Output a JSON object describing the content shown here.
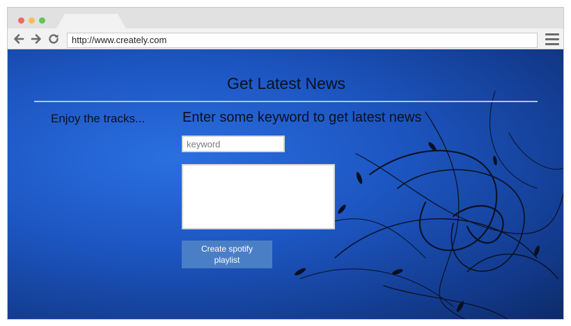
{
  "browser": {
    "url": "http://www.creately.com",
    "icons": {
      "back": "arrow-left-icon",
      "forward": "arrow-right-icon",
      "reload": "reload-icon",
      "menu": "hamburger-menu-icon"
    },
    "window_controls": [
      "close",
      "minimize",
      "maximize"
    ]
  },
  "page": {
    "title": "Get Latest News",
    "sidebar_text": "Enjoy the tracks...",
    "prompt": "Enter some keyword to get latest news",
    "keyword_placeholder": "keyword",
    "results_value": "",
    "create_button_label": "Create spotify playlist"
  },
  "colors": {
    "background_blue": "#1d56c2",
    "button_blue": "#4a7fc6",
    "text_dark": "#0b1020"
  }
}
